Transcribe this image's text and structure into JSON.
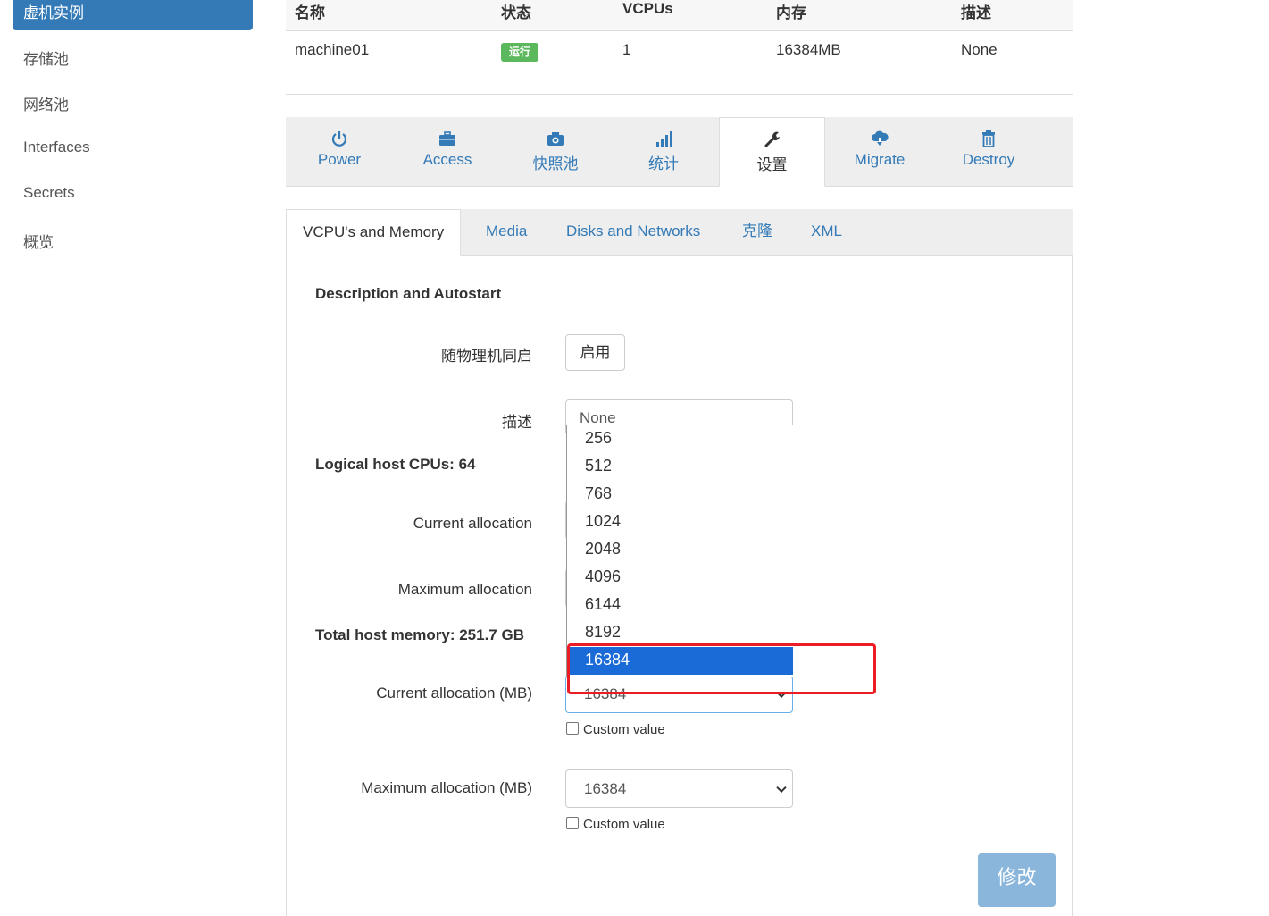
{
  "sidebar": {
    "active": "虚机实例",
    "items": [
      "存储池",
      "网络池",
      "Interfaces",
      "Secrets",
      "概览"
    ]
  },
  "table": {
    "headers": [
      "名称",
      "状态",
      "VCPUs",
      "内存",
      "描述"
    ],
    "row": {
      "name": "machine01",
      "status": "运行",
      "vcpus": "1",
      "memory": "16384MB",
      "description": "None"
    }
  },
  "action_tabs": [
    {
      "label": "Power",
      "icon": "power-icon"
    },
    {
      "label": "Access",
      "icon": "briefcase-icon"
    },
    {
      "label": "快照池",
      "icon": "camera-icon"
    },
    {
      "label": "统计",
      "icon": "bar-chart-icon"
    },
    {
      "label": "设置",
      "icon": "wrench-icon"
    },
    {
      "label": "Migrate",
      "icon": "cloud-download-icon"
    },
    {
      "label": "Destroy",
      "icon": "trash-icon"
    }
  ],
  "sub_tabs": [
    "VCPU's and Memory",
    "Media",
    "Disks and Networks",
    "克隆",
    "XML"
  ],
  "form": {
    "section_title": "Description and Autostart",
    "autostart_label": "随物理机同启",
    "autostart_button": "启用",
    "description_label": "描述",
    "description_value": "None",
    "logical_cpus": "Logical host CPUs: 64",
    "cpu_current_label": "Current allocation",
    "cpu_max_label": "Maximum allocation",
    "total_memory": "Total host memory: 251.7 GB",
    "mem_current_label": "Current allocation (MB)",
    "mem_current_value": "16384",
    "mem_max_label": "Maximum allocation (MB)",
    "mem_max_value": "16384",
    "custom_value_label": "Custom value",
    "submit": "修改"
  },
  "dropdown": {
    "options": [
      "256",
      "512",
      "768",
      "1024",
      "2048",
      "4096",
      "6144",
      "8192",
      "16384"
    ],
    "selected": "16384"
  },
  "colors": {
    "primary": "#337ab7",
    "running_badge": "#5cb85c",
    "highlight": "#1a6ad8",
    "annotation": "#ec1c24"
  }
}
